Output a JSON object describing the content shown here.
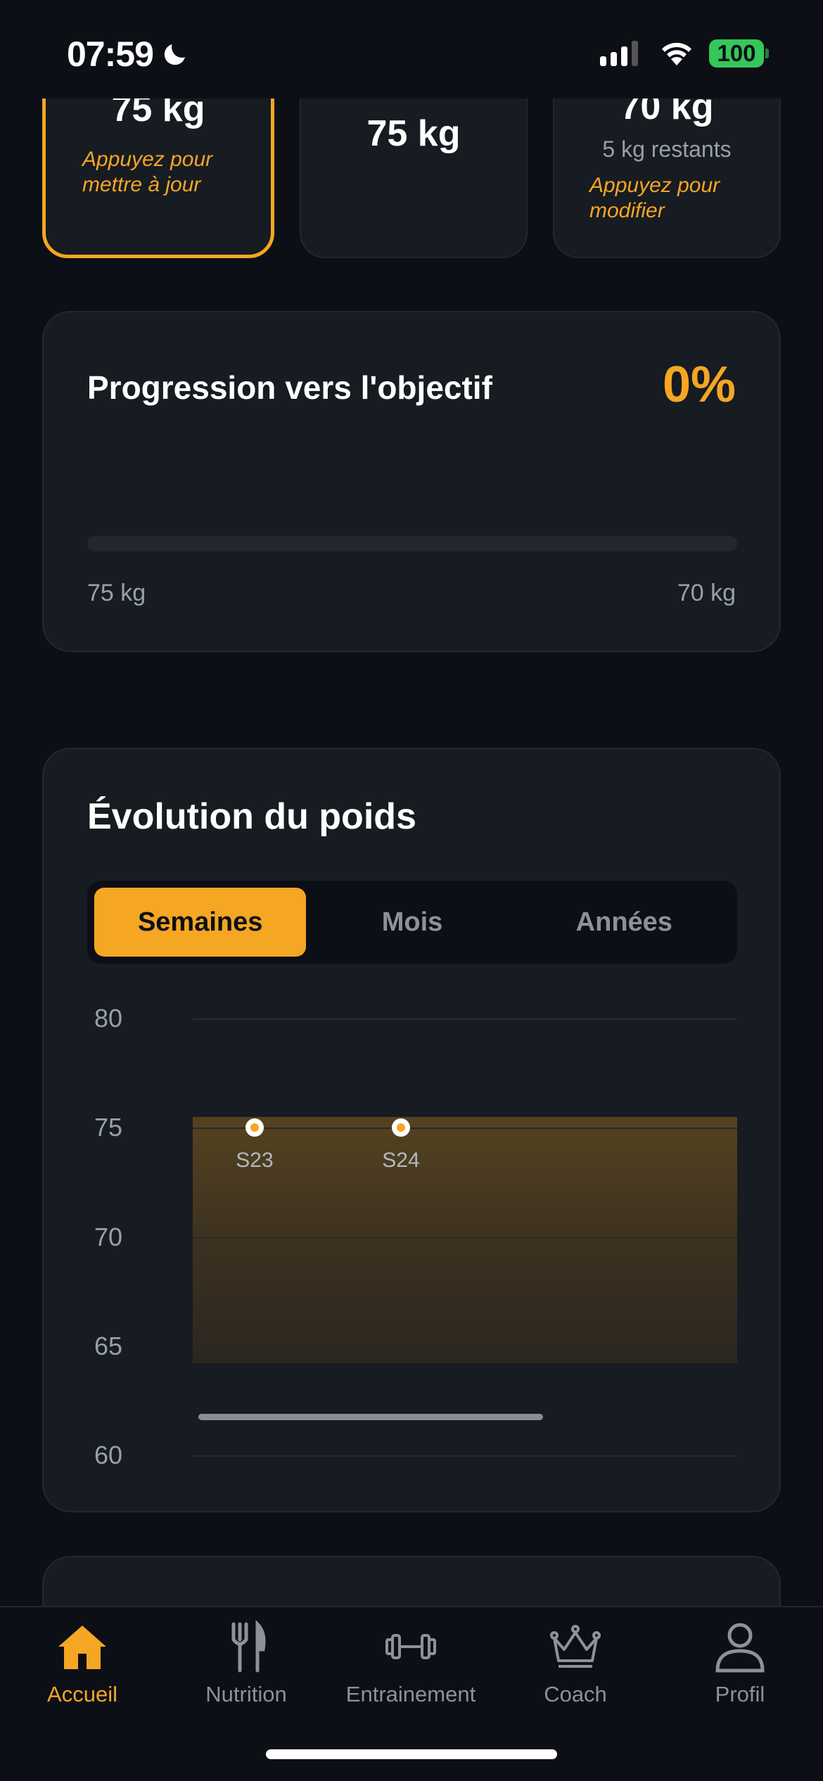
{
  "status_bar": {
    "time": "07:59",
    "battery": "100"
  },
  "weight_cards": {
    "current": {
      "value": "75 kg",
      "hint": "Appuyez pour mettre à jour"
    },
    "start": {
      "value": "75 kg"
    },
    "goal": {
      "value": "70 kg",
      "remaining": "5 kg restants",
      "hint": "Appuyez pour modifier"
    }
  },
  "progress": {
    "title": "Progression vers l'objectif",
    "percent_label": "0%",
    "percent": 0,
    "start_label": "75 kg",
    "end_label": "70 kg"
  },
  "weight_chart": {
    "title": "Évolution du poids",
    "tabs": [
      {
        "label": "Semaines",
        "active": true
      },
      {
        "label": "Mois",
        "active": false
      },
      {
        "label": "Années",
        "active": false
      }
    ]
  },
  "chart_data": {
    "type": "scatter",
    "title": "Évolution du poids",
    "x": [
      "S23",
      "S24"
    ],
    "values": [
      75,
      75
    ],
    "ylim": [
      60,
      80
    ],
    "yticks": [
      80,
      75,
      70,
      65,
      60
    ],
    "target_band": [
      65,
      75.5
    ],
    "grid": true
  },
  "tab_bar": {
    "items": [
      {
        "label": "Accueil",
        "icon": "home-icon",
        "active": true
      },
      {
        "label": "Nutrition",
        "icon": "fork-knife-icon",
        "active": false
      },
      {
        "label": "Entrainement",
        "icon": "dumbbell-icon",
        "active": false
      },
      {
        "label": "Coach",
        "icon": "crown-icon",
        "active": false
      },
      {
        "label": "Profil",
        "icon": "person-icon",
        "active": false
      }
    ]
  },
  "colors": {
    "accent": "#f5a623",
    "background": "#0c0f15",
    "card": "#171b22",
    "battery": "#34c759"
  }
}
